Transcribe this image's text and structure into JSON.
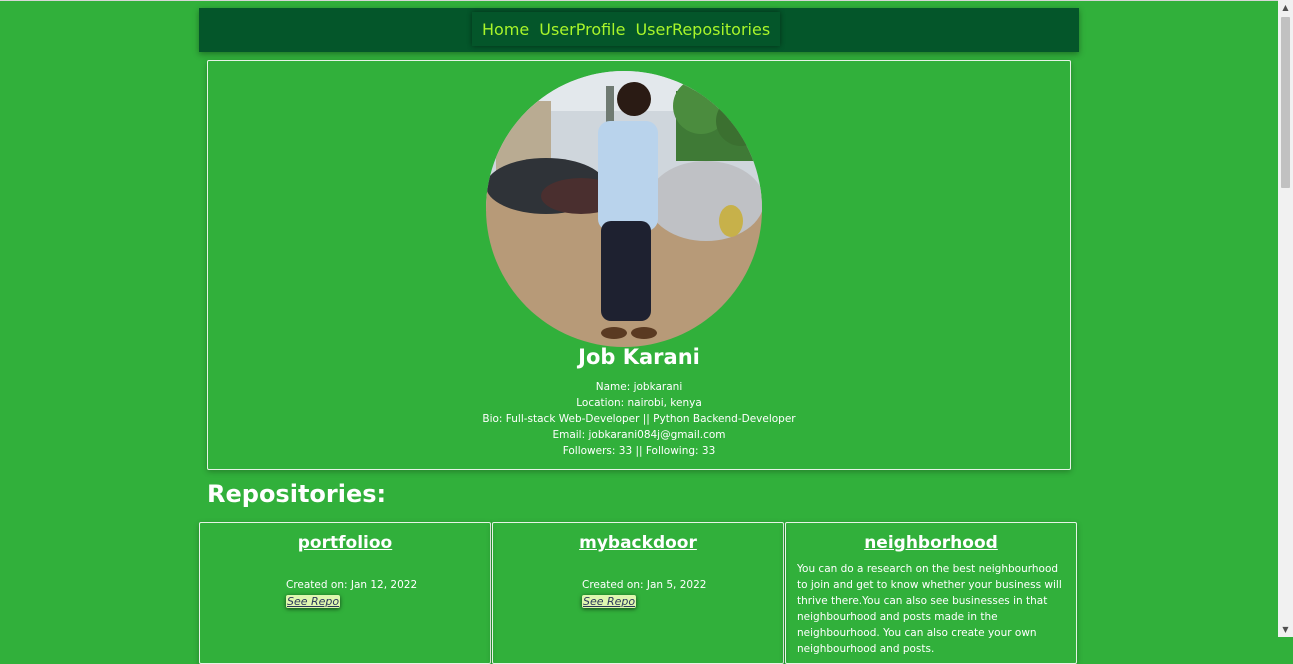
{
  "nav": {
    "items": [
      {
        "label": "Home"
      },
      {
        "label": "UserProfile"
      },
      {
        "label": "UserRepositories"
      }
    ]
  },
  "profile": {
    "display_name": "Job Karani",
    "name_line": "Name: jobkarani",
    "location_line": "Location: nairobi, kenya",
    "bio_line": "Bio: Full-stack Web-Developer || Python Backend-Developer",
    "email_line": "Email: jobkarani084j@gmail.com",
    "followers_line": "Followers: 33 || Following: 33"
  },
  "repositories": {
    "heading": "Repositories:",
    "cards": [
      {
        "name": "portfolioo",
        "created": "Created on: Jan 12, 2022",
        "link": "See Repo"
      },
      {
        "name": "mybackdoor",
        "created": "Created on: Jan 5, 2022",
        "link": "See Repo"
      },
      {
        "name": "neighborhood",
        "description": "You can do a research on the best neighbourhood to join and get to know whether your business will thrive there.You can also see businesses in that neighbourhood and posts made in the neighbourhood. You can also create your own neighbourhood and posts."
      }
    ]
  },
  "scrollbar": {
    "up_icon": "triangle-up",
    "down_icon": "triangle-down"
  }
}
